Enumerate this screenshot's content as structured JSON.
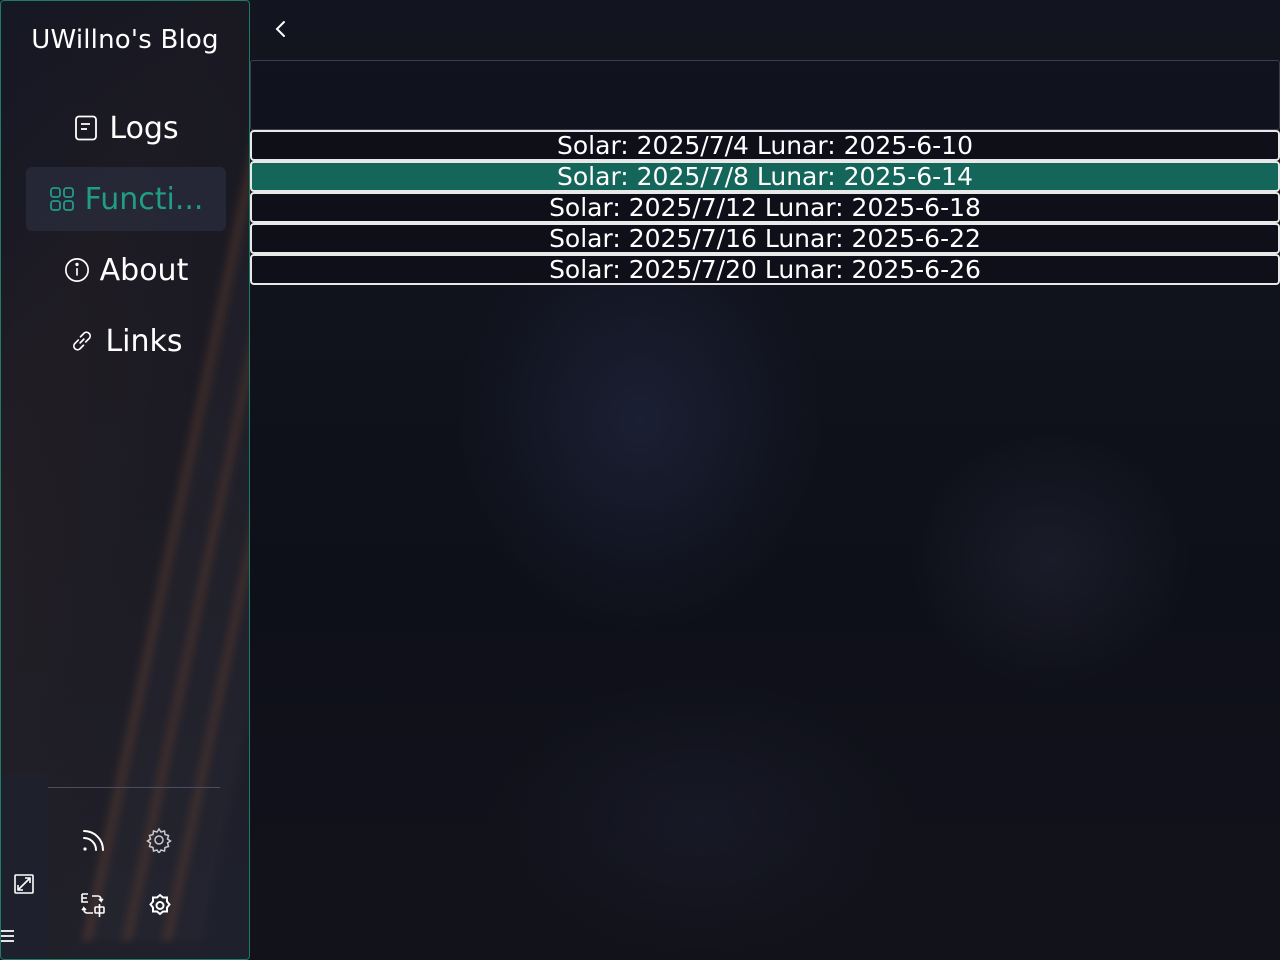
{
  "sidebar": {
    "blog_title": "UWillno's Blog",
    "nav": [
      {
        "label": "Logs",
        "icon": "document-icon",
        "active": false
      },
      {
        "label": "Functi...",
        "icon": "grid-icon",
        "active": true
      },
      {
        "label": "About",
        "icon": "info-icon",
        "active": false
      },
      {
        "label": "Links",
        "icon": "link-icon",
        "active": false
      }
    ],
    "footer_icons": [
      "rss-icon",
      "gear-icon",
      "translate-icon",
      "badge-settings-icon"
    ],
    "strip_icons": [
      "expand-icon",
      "menu-icon"
    ]
  },
  "dates": [
    {
      "text": "Solar: 2025/7/4 Lunar: 2025-6-10",
      "selected": false
    },
    {
      "text": "Solar: 2025/7/8 Lunar: 2025-6-14",
      "selected": true
    },
    {
      "text": "Solar: 2025/7/12 Lunar: 2025-6-18",
      "selected": false
    },
    {
      "text": "Solar: 2025/7/16 Lunar: 2025-6-22",
      "selected": false
    },
    {
      "text": "Solar: 2025/7/20 Lunar: 2025-6-26",
      "selected": false
    }
  ],
  "colors": {
    "accent": "#1f9d86",
    "selected_row": "#14665a",
    "background": "#0f111c"
  }
}
